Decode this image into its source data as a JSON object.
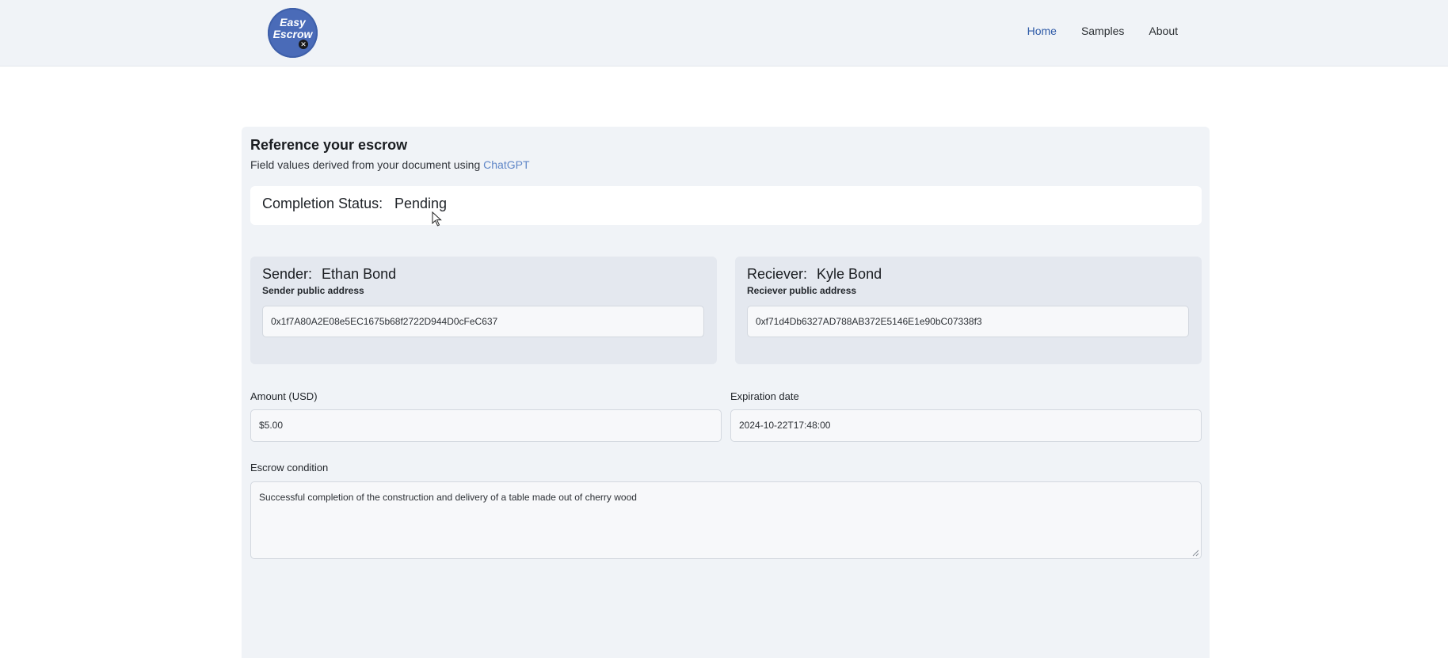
{
  "nav": {
    "logo_line1": "Easy",
    "logo_line2": "Escrow",
    "logo_badge": "✕",
    "links": [
      {
        "label": "Home",
        "active": true
      },
      {
        "label": "Samples",
        "active": false
      },
      {
        "label": "About",
        "active": false
      }
    ]
  },
  "card": {
    "title": "Reference your escrow",
    "subtitle_prefix": "Field values derived from your document using ",
    "subtitle_link": "ChatGPT",
    "status": {
      "label": "Completion Status:",
      "value": "Pending"
    },
    "sender": {
      "label": "Sender:",
      "name": "Ethan Bond",
      "address_label": "Sender public address",
      "address": "0x1f7A80A2E08e5EC1675b68f2722D944D0cFeC637"
    },
    "receiver": {
      "label": "Reciever:",
      "name": "Kyle Bond",
      "address_label": "Reciever public address",
      "address": "0xf71d4Db6327AD788AB372E5146E1e90bC07338f3"
    },
    "amount": {
      "label": "Amount (USD)",
      "value": "$5.00"
    },
    "expiration": {
      "label": "Expiration date",
      "value": "2024-10-22T17:48:00"
    },
    "condition": {
      "label": "Escrow condition",
      "value": "Successful completion of the construction and delivery of a table made out of cherry wood"
    }
  },
  "colors": {
    "nav_bg": "#f0f3f7",
    "logo_bg": "#4a6bb8",
    "active_link": "#2e5aa7",
    "link_accent": "#5f86c7",
    "card_bg": "#f0f3f7",
    "party_bg": "#e4e8ef"
  },
  "icons": {
    "cursor": "mouse-pointer-icon",
    "badge": "close-icon",
    "grip": "resize-grip-icon"
  }
}
